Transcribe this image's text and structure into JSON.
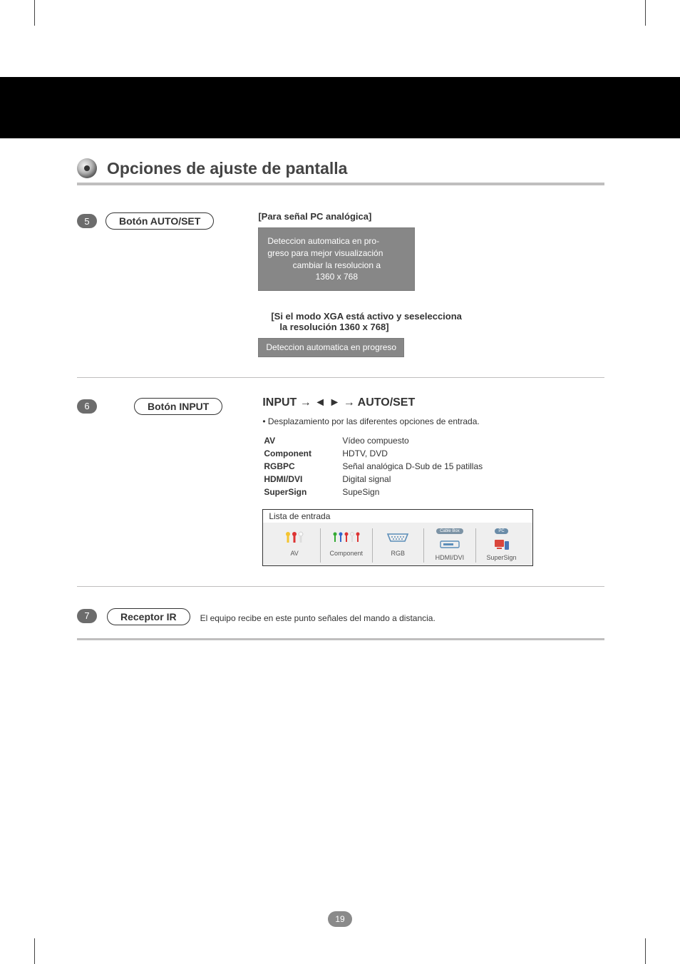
{
  "page": {
    "title": "Opciones de ajuste de pantalla",
    "page_number": "19"
  },
  "section5": {
    "num": "5",
    "button_label": "Botón AUTO/SET",
    "sub_a": "[Para señal PC analógica]",
    "osd_a_l1": "Deteccion automatica en pro-",
    "osd_a_l2": "greso para mejor visualización",
    "osd_a_l3": "cambiar la resolucion a",
    "osd_a_l4": "1360 x 768",
    "sub_b_l1": "[Si el modo XGA está activo y seselecciona",
    "sub_b_l2": "la resolución 1360 x 768]",
    "osd_b": "Deteccion automatica en progreso"
  },
  "section6": {
    "num": "6",
    "button_label": "Botón INPUT",
    "seq_prefix": "INPUT  →",
    "seq_suffix": "→  AUTO/SET",
    "note": "• Desplazamiento por las diferentes opciones de entrada.",
    "rows": [
      {
        "k": "AV",
        "v": "Vídeo compuesto"
      },
      {
        "k": "Component",
        "v": "HDTV, DVD"
      },
      {
        "k": "RGBPC",
        "v": "Señal analógica D-Sub de 15 patillas"
      },
      {
        "k": "HDMI/DVI",
        "v": "Digital signal"
      },
      {
        "k": "SuperSign",
        "v": "SupeSign"
      }
    ],
    "list_title": "Lista de entrada",
    "src_labels": {
      "av": "AV",
      "component": "Component",
      "rgb": "RGB",
      "hdmidvi": "HDMI/DVI",
      "supersign": "SuperSign",
      "tag_cable": "Cable Box",
      "tag_pc": "PC"
    }
  },
  "section7": {
    "num": "7",
    "button_label": "Receptor IR",
    "text": "El equipo recibe en este punto señales del mando a distancia."
  }
}
